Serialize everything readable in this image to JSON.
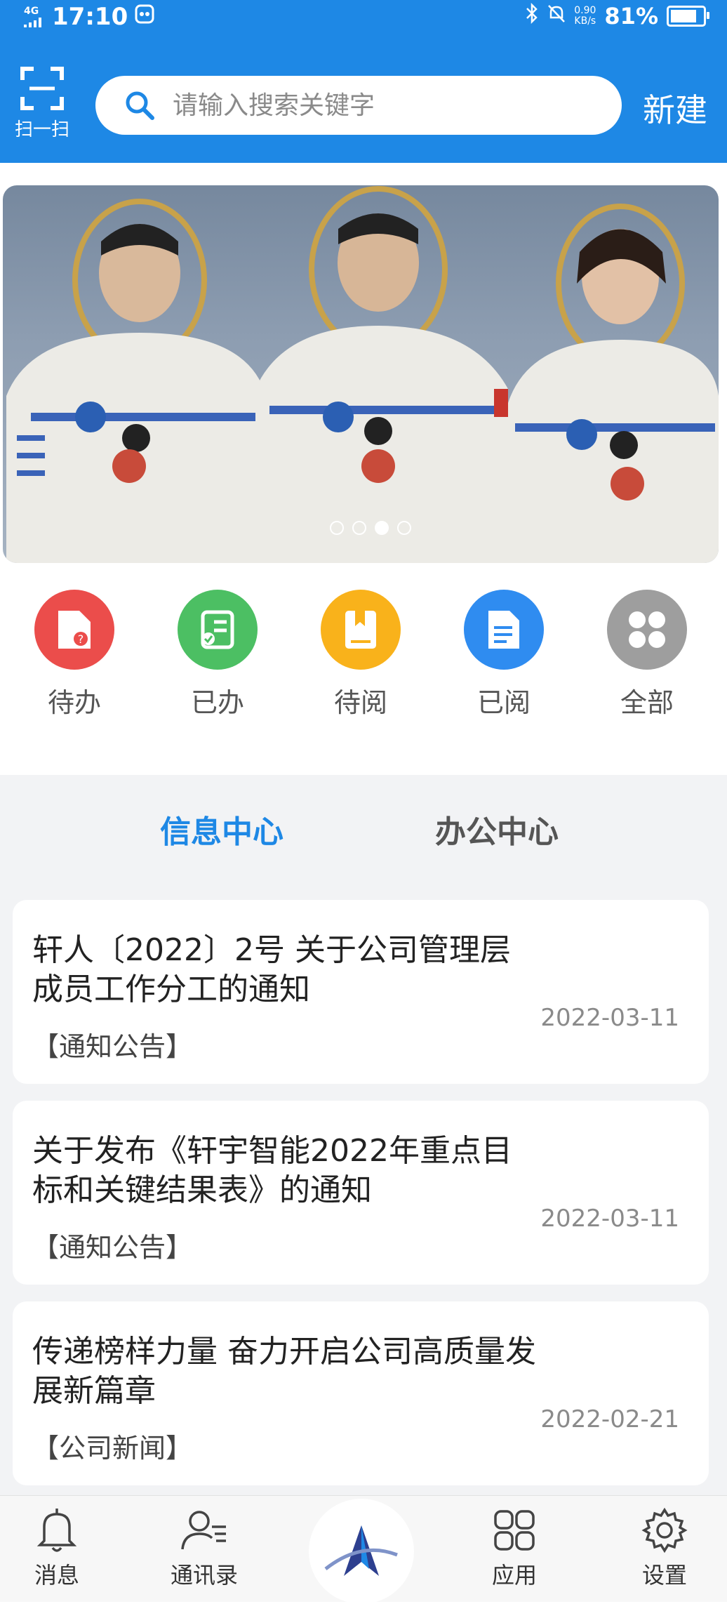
{
  "status_bar": {
    "network": "4G",
    "time": "17:10",
    "speed_value": "0.90",
    "speed_unit": "KB/s",
    "battery": "81%",
    "battery_level": 0.81
  },
  "header": {
    "scan_label": "扫一扫",
    "search_placeholder": "请输入搜索关键字",
    "new_label": "新建"
  },
  "banner": {
    "dots": 4,
    "active_dot": 3
  },
  "actions": [
    {
      "label": "待办",
      "icon": "pending-doc-icon",
      "color": "#eb4d4b"
    },
    {
      "label": "已办",
      "icon": "done-list-icon",
      "color": "#4cbf63"
    },
    {
      "label": "待阅",
      "icon": "bookmark-book-icon",
      "color": "#f9b21b"
    },
    {
      "label": "已阅",
      "icon": "read-doc-icon",
      "color": "#2f8cf0"
    },
    {
      "label": "全部",
      "icon": "grid-all-icon",
      "color": "#9e9e9e"
    }
  ],
  "tabs": [
    {
      "label": "信息中心",
      "active": true
    },
    {
      "label": "办公中心",
      "active": false
    }
  ],
  "news": [
    {
      "title": "轩人〔2022〕2号 关于公司管理层成员工作分工的通知",
      "category": "【通知公告】",
      "date": "2022-03-11"
    },
    {
      "title": "关于发布《轩宇智能2022年重点目标和关键结果表》的通知",
      "category": "【通知公告】",
      "date": "2022-03-11"
    },
    {
      "title": "传递榜样力量 奋力开启公司高质量发展新篇章",
      "category": "【公司新闻】",
      "date": "2022-02-21"
    }
  ],
  "bottom_nav": [
    {
      "label": "消息",
      "icon": "bell-icon"
    },
    {
      "label": "通讯录",
      "icon": "contacts-icon"
    },
    {
      "label": "",
      "icon": "logo-icon"
    },
    {
      "label": "应用",
      "icon": "apps-icon"
    },
    {
      "label": "设置",
      "icon": "gear-icon"
    }
  ],
  "colors": {
    "primary": "#1e88e5",
    "background": "#f2f3f5"
  }
}
